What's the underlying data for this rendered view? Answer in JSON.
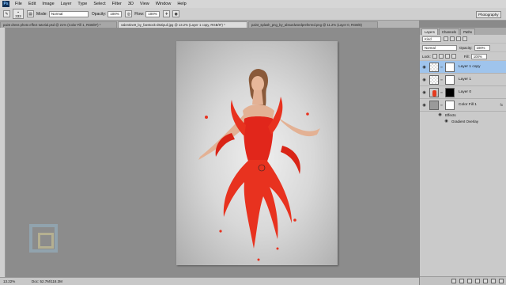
{
  "menu": [
    "File",
    "Edit",
    "Image",
    "Layer",
    "Type",
    "Select",
    "Filter",
    "3D",
    "View",
    "Window",
    "Help"
  ],
  "logo": "Ps",
  "options": {
    "brush_size": "333",
    "mode_label": "Mode:",
    "mode_value": "Normal",
    "opacity_label": "Opacity:",
    "opacity_value": "100%",
    "flow_label": "Flow:",
    "flow_value": "100%",
    "workspace": "Photography"
  },
  "doc_tabs": [
    {
      "label": "paint dress photo effect tutorial.psd @ 21% (Color Fill 1, RGB/8*) *"
    },
    {
      "label": "valentine9_by_faestock-d62ipuil.jpg @ 13.2% (Layer 1 copy, RGB/8*) *"
    },
    {
      "label": "paint_splash_png_by_absurdwordpreferred.png @ 11.2% (Layer 0, RGB/8)"
    }
  ],
  "status": {
    "zoom": "13.22%",
    "doc": "Doc: 52.7M/118.3M"
  },
  "panel": {
    "tabs": [
      "Layers",
      "Channels",
      "Paths"
    ],
    "kind": "Kind",
    "blend": "Normal",
    "opacity_label": "Opacity:",
    "opacity_value": "100%",
    "lock_label": "Lock:",
    "fill_label": "Fill:",
    "fill_value": "100%",
    "layers": [
      {
        "name": "Layer 1 copy"
      },
      {
        "name": "Layer 1"
      },
      {
        "name": "Layer 0"
      },
      {
        "name": "Color Fill 1"
      }
    ],
    "effects_label": "Effects",
    "effect_name": "Gradient Overlay",
    "fx": "fx"
  }
}
